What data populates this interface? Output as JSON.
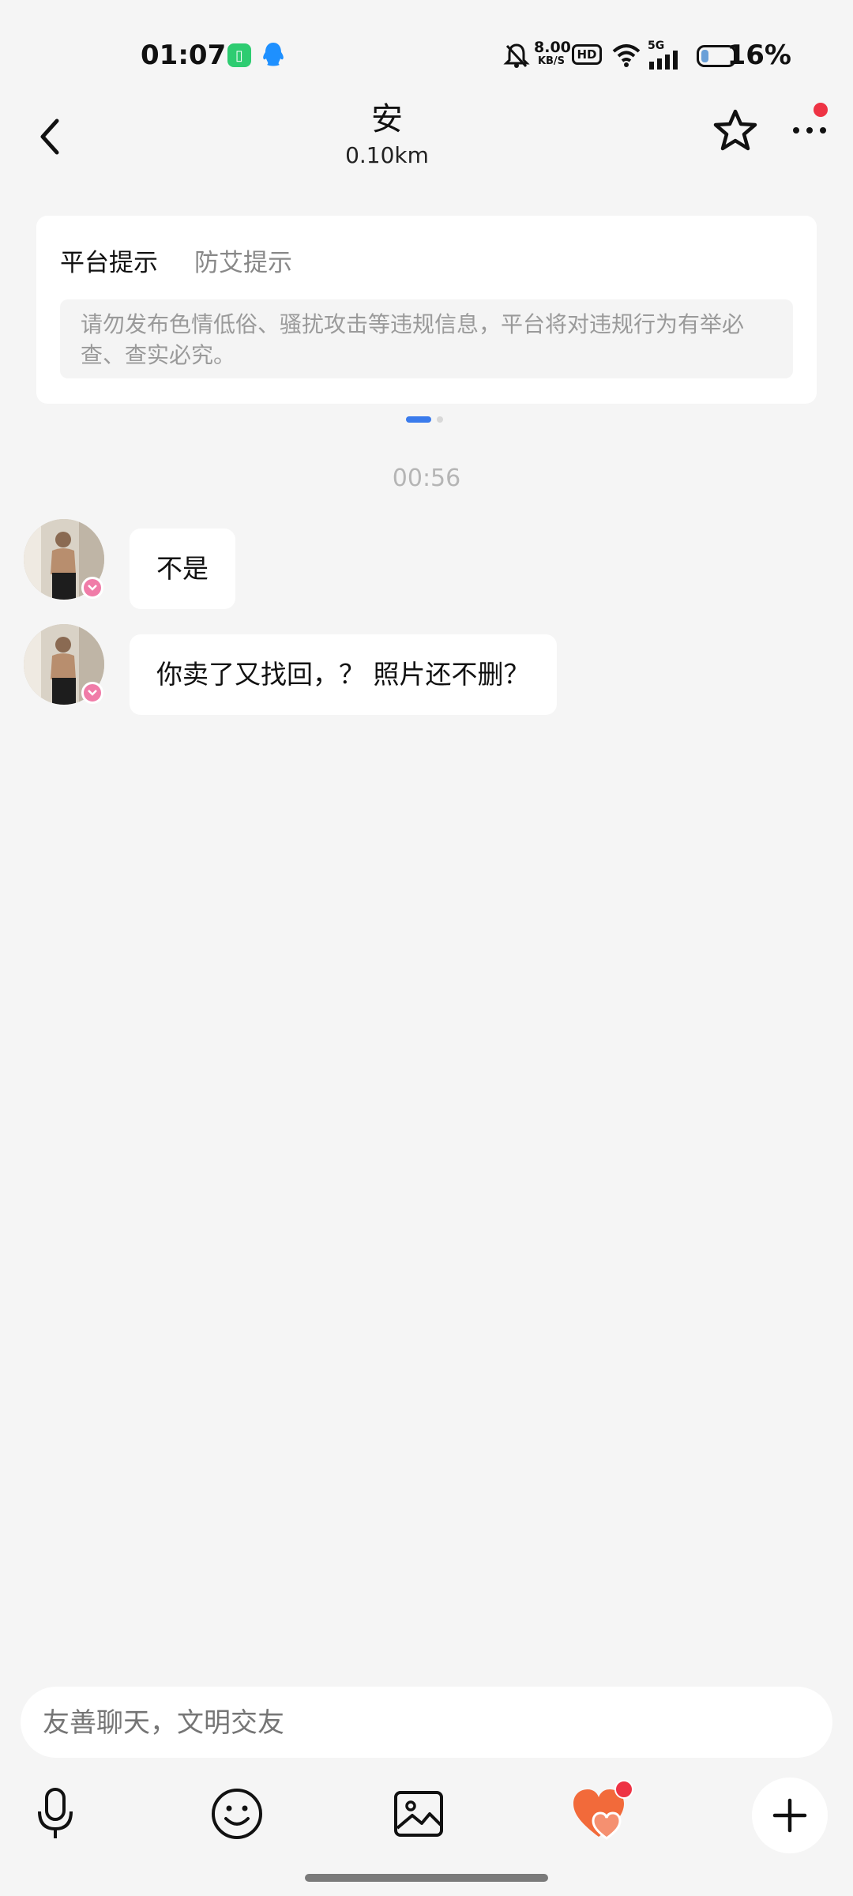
{
  "status_bar": {
    "time": "01:07",
    "net_speed_value": "8.00",
    "net_speed_unit": "KB/S",
    "hd_label": "HD",
    "signal_label": "5G",
    "battery_percent": "16%",
    "battery_level": 0.16
  },
  "header": {
    "name": "安",
    "distance": "0.10km",
    "has_notification_dot": true
  },
  "tips": {
    "tabs": [
      {
        "label": "平台提示",
        "active": true
      },
      {
        "label": "防艾提示",
        "active": false
      }
    ],
    "content": "请勿发布色情低俗、骚扰攻击等违规信息，平台将对违规行为有举必查、查实必究。",
    "pager": {
      "pages": 2,
      "active": 0
    }
  },
  "chat": {
    "timestamp": "00:56",
    "messages": [
      {
        "text": "不是",
        "side": "left"
      },
      {
        "text": "你卖了又找回，？ 照片还不删？",
        "side": "left"
      }
    ]
  },
  "input": {
    "placeholder": "友善聊天，文明交友"
  },
  "toolbar": {
    "icons": [
      "microphone-icon",
      "emoji-icon",
      "image-icon",
      "heart-icon",
      "plus-icon"
    ]
  },
  "colors": {
    "accent_blue": "#3a7bec",
    "notification_red": "#ee3344",
    "heart_orange": "#f26a3a",
    "badge_pink": "#f07ca8"
  }
}
